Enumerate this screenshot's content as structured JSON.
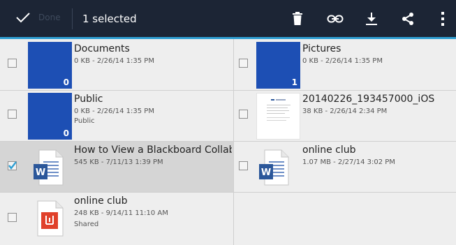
{
  "action_bar": {
    "done_label": "Done",
    "selected_text": "1 selected",
    "icons": [
      "check-icon",
      "trash-icon",
      "link-icon",
      "download-icon",
      "share-icon",
      "overflow-menu-icon"
    ]
  },
  "colors": {
    "action_bar_bg": "#1c2535",
    "accent_line": "#2f9ed2",
    "folder_blue": "#1d4fb4",
    "word_blue": "#2b579a",
    "acrobat_red": "#e0402a",
    "selected_row": "#d5d5d5"
  },
  "items": [
    {
      "name": "Documents",
      "meta": "0 KB - 2/26/14 1:35 PM",
      "sub": "",
      "kind": "folder",
      "count": "0",
      "selected": false
    },
    {
      "name": "Pictures",
      "meta": "0 KB - 2/26/14 1:35 PM",
      "sub": "",
      "kind": "folder",
      "count": "1",
      "selected": false
    },
    {
      "name": "Public",
      "meta": "0 KB - 2/26/14 1:35 PM",
      "sub": "Public",
      "kind": "folder",
      "count": "0",
      "selected": false
    },
    {
      "name": "20140226_193457000_iOS",
      "meta": "38 KB - 2/26/14 2:34 PM",
      "sub": "",
      "kind": "document-image",
      "count": "",
      "selected": false
    },
    {
      "name": "How to View a Blackboard Collab...",
      "meta": "545 KB - 7/11/13 1:39 PM",
      "sub": "",
      "kind": "word",
      "count": "",
      "selected": true
    },
    {
      "name": "online club",
      "meta": "1.07 MB - 2/27/14 3:02 PM",
      "sub": "",
      "kind": "word",
      "count": "",
      "selected": false
    },
    {
      "name": "online club",
      "meta": "248 KB - 9/14/11 11:10 AM",
      "sub": "Shared",
      "kind": "pdf",
      "count": "",
      "selected": false
    }
  ]
}
